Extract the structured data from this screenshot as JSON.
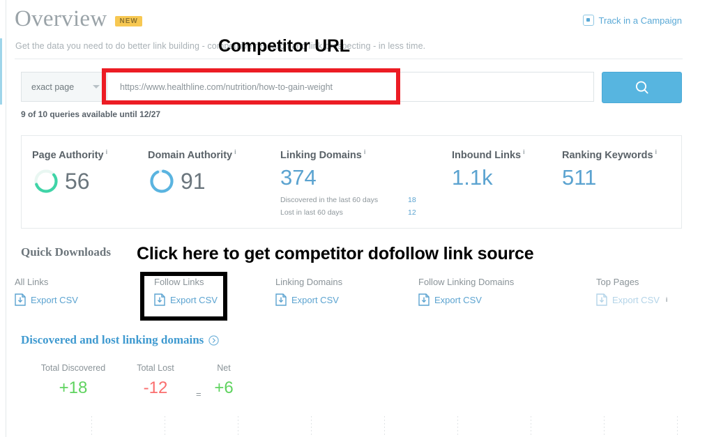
{
  "header": {
    "title": "Overview",
    "badge": "NEW",
    "subtitle": "Get the data you need to do better link building - competitive research and link prospecting - in less time.",
    "track_label": "Track in a Campaign",
    "track_icon": "add-square-icon"
  },
  "search": {
    "scope_selected": "exact page",
    "caret_icon": "chevron-down-icon",
    "url_value": "https://www.healthline.com/nutrition/how-to-gain-weight",
    "search_icon": "magnifier-icon",
    "quota_text": "9 of 10 queries available until 12/27"
  },
  "metrics": [
    {
      "label": "Page Authority",
      "info": "i",
      "value": "56",
      "ring": true,
      "ring_pct": 56,
      "ring_color": "#3fd4a7"
    },
    {
      "label": "Domain Authority",
      "info": "i",
      "value": "91",
      "ring": true,
      "ring_pct": 91,
      "ring_color": "#5ab4e0"
    },
    {
      "label": "Linking Domains",
      "info": "i",
      "value": "374",
      "ring": false,
      "sub": [
        {
          "label": "Discovered in the last 60 days",
          "value": "18"
        },
        {
          "label": "Lost in last 60 days",
          "value": "12"
        }
      ]
    },
    {
      "label": "Inbound Links",
      "info": "i",
      "value": "1.1k",
      "ring": false
    },
    {
      "label": "Ranking Keywords",
      "info": "i",
      "value": "511",
      "ring": false
    }
  ],
  "quick_downloads": {
    "title": "Quick Downloads",
    "items": [
      {
        "label": "All Links",
        "action": "Export CSV",
        "icon": "download-file-icon",
        "disabled": false,
        "info": ""
      },
      {
        "label": "Follow Links",
        "action": "Export CSV",
        "icon": "download-file-icon",
        "disabled": false,
        "info": ""
      },
      {
        "label": "Linking Domains",
        "action": "Export CSV",
        "icon": "download-file-icon",
        "disabled": false,
        "info": ""
      },
      {
        "label": "Follow Linking Domains",
        "action": "Export CSV",
        "icon": "download-file-icon",
        "disabled": false,
        "info": ""
      },
      {
        "label": "Top Pages",
        "action": "Export CSV",
        "icon": "download-file-icon",
        "disabled": true,
        "info": "i"
      }
    ]
  },
  "discovered": {
    "title": "Discovered and lost linking domains",
    "help_icon": "chevron-circle-icon",
    "equals": "=",
    "stats": [
      {
        "label": "Total Discovered",
        "value": "+18",
        "color": "#5fd35f"
      },
      {
        "label": "Total Lost",
        "value": "-12",
        "color": "#fa6e6e"
      },
      {
        "label": "Net",
        "value": "+6",
        "color": "#5fd35f"
      }
    ]
  },
  "annotations": [
    {
      "name": "competitor-url-callout",
      "text": "Competitor URL"
    },
    {
      "name": "dofollow-callout",
      "text": "Click here to get competitor dofollow link source"
    }
  ],
  "colors": {
    "accent_blue": "#57b5e0",
    "link_blue": "#5ba3d0",
    "badge_amber": "#f7c852",
    "highlight_red": "#ec1c24",
    "highlight_black": "#000000"
  }
}
